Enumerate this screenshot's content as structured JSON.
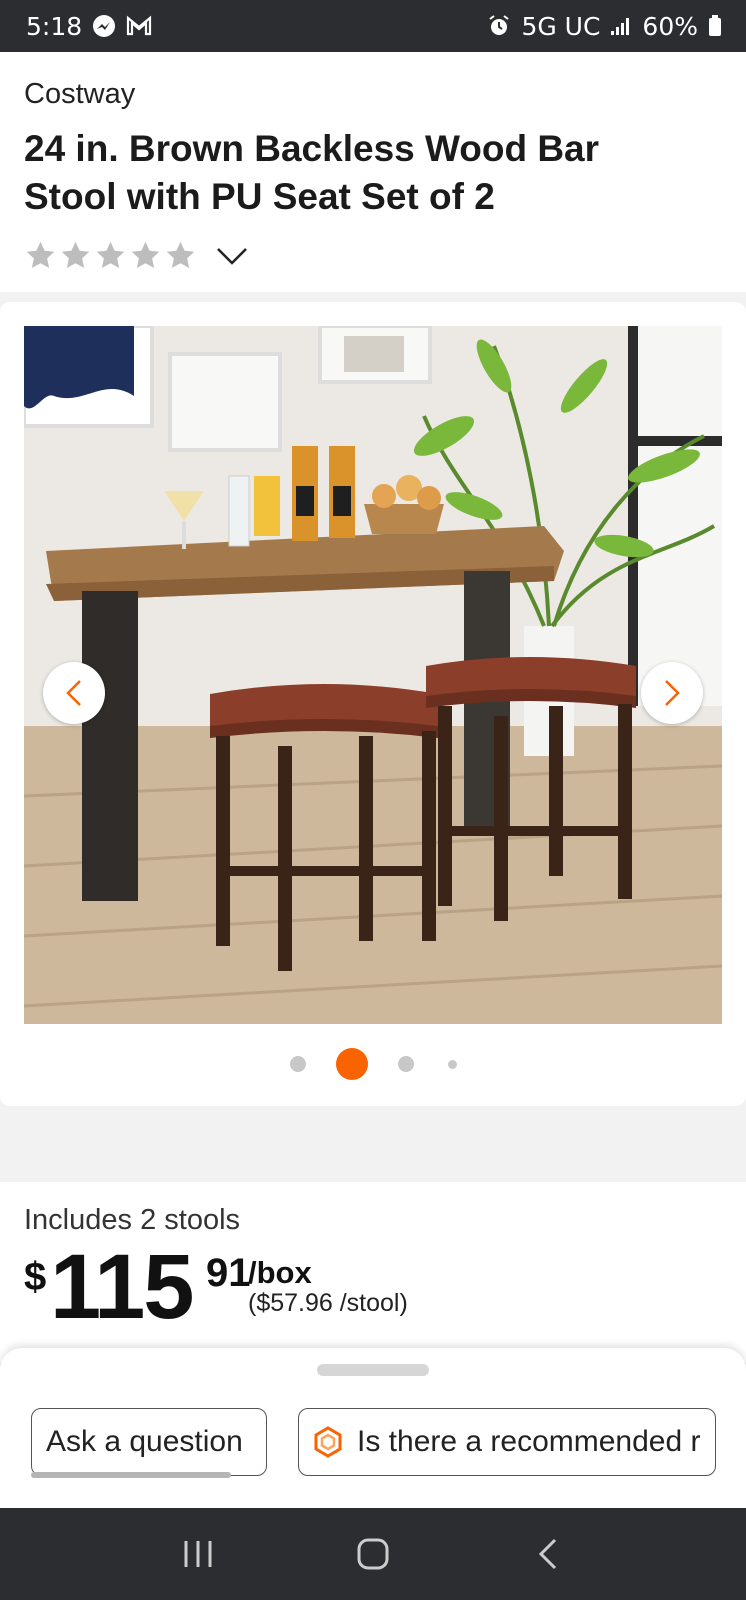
{
  "status_bar": {
    "time": "5:18",
    "network": "5G UC",
    "battery": "60%"
  },
  "product": {
    "brand": "Costway",
    "title": "24 in. Brown Backless Wood Bar Stool with PU Seat Set of 2",
    "rating_stars": 0
  },
  "gallery": {
    "image_alt": "Two brown backless bar stools beside a wooden bar table",
    "image_count": 4,
    "active_index": 1
  },
  "pricing": {
    "includes": "Includes 2 stools",
    "currency": "$",
    "dollars": "115",
    "cents": "91",
    "per_unit": "/box",
    "unit_price": "($57.96 /stool)"
  },
  "bottom_sheet": {
    "ask_label": "Ask a question",
    "suggestion_label": "Is there a recommended r"
  },
  "colors": {
    "accent": "#f96302",
    "star_empty": "#bdbdbd",
    "system_bar": "#2b2d31"
  }
}
